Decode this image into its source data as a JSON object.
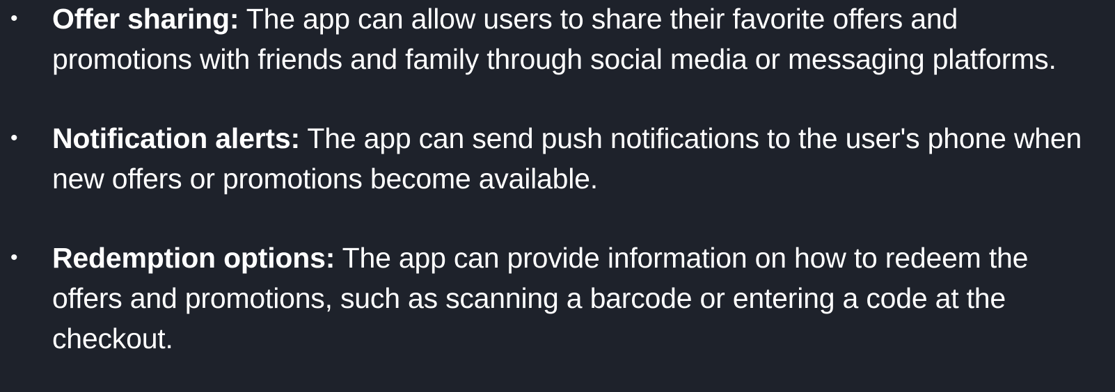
{
  "background_color": "#1e222b",
  "text_color": "#ffffff",
  "bullet_glyph": "•",
  "items": [
    {
      "term": "Offer sharing:",
      "text": " The app can allow users to share their favorite offers and promotions with friends and family through social media or messaging platforms."
    },
    {
      "term": "Notification alerts:",
      "text": " The app can send push notifications to the user's phone when new offers or promotions become available."
    },
    {
      "term": "Redemption options:",
      "text": " The app can provide information on how to redeem the offers and promotions, such as scanning a barcode or entering a code at the checkout."
    }
  ]
}
